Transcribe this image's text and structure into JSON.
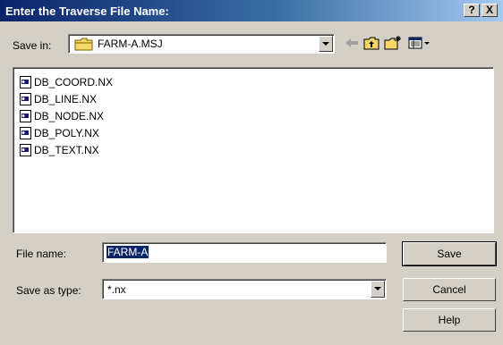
{
  "window": {
    "title": "Enter the Traverse File Name:",
    "help_glyph": "?",
    "close_glyph": "X"
  },
  "toolbar": {
    "save_in_label": "Save in:",
    "save_in_value": "FARM-A.MSJ",
    "icons": [
      "back-arrow-icon",
      "up-one-level-icon",
      "new-folder-icon",
      "view-menu-icon"
    ]
  },
  "files": [
    "DB_COORD.NX",
    "DB_LINE.NX",
    "DB_NODE.NX",
    "DB_POLY.NX",
    "DB_TEXT.NX"
  ],
  "form": {
    "file_name_label": "File name:",
    "file_name_value": "FARM-A",
    "save_as_type_label": "Save as type:",
    "save_as_type_value": "*.nx"
  },
  "buttons": {
    "save": "Save",
    "cancel": "Cancel",
    "help": "Help"
  },
  "colors": {
    "title_start": "#0a246a",
    "title_end": "#a6caf0",
    "face": "#d4d0c8",
    "selection": "#0a246a"
  }
}
